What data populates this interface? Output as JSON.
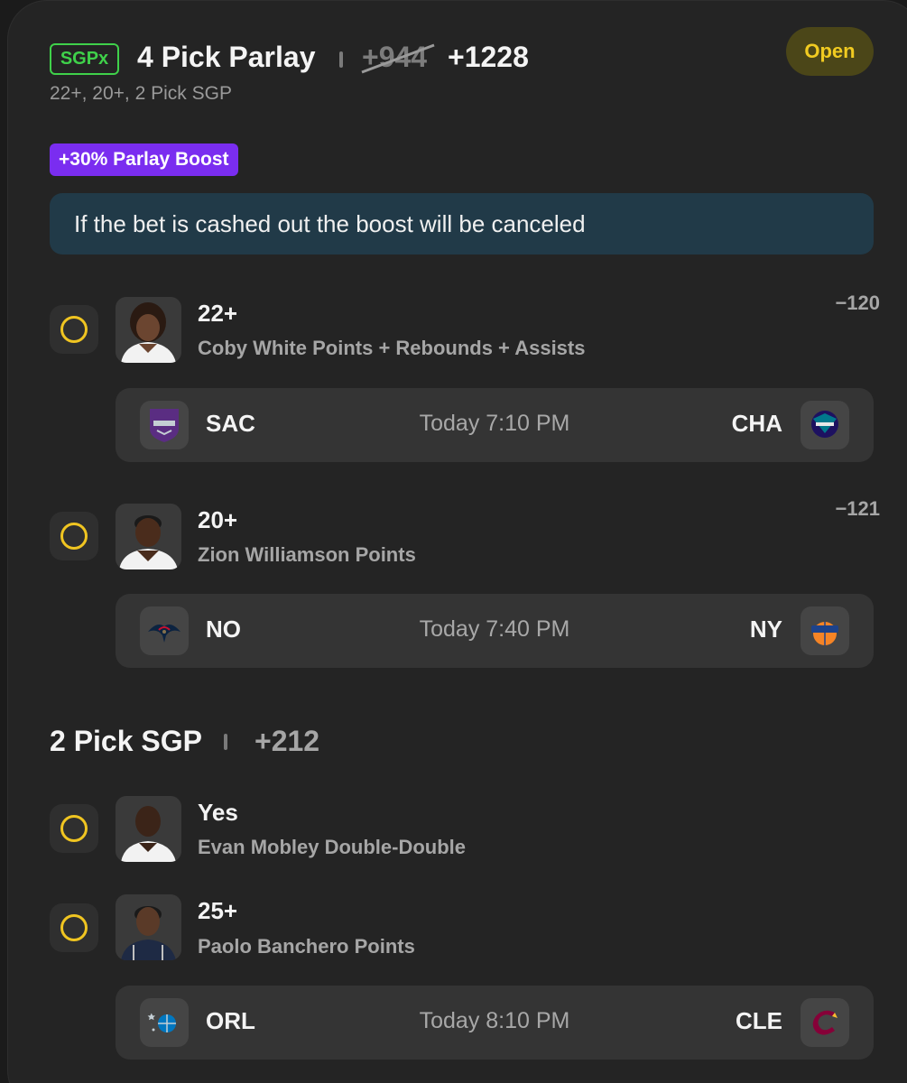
{
  "header": {
    "badge": "SGPx",
    "title": "4 Pick Parlay",
    "odds_original": "+944",
    "odds_boosted": "+1228",
    "subtitle": "22+, 20+, 2 Pick SGP",
    "status": "Open"
  },
  "boost": {
    "badge": "+30% Parlay Boost",
    "notice": "If the bet is cashed out the boost will be canceled"
  },
  "picks": [
    {
      "line": "22+",
      "description": "Coby White Points + Rebounds + Assists",
      "odds": "−120",
      "headshot_icon": "player-headshot-icon"
    },
    {
      "line": "20+",
      "description": "Zion Williamson Points",
      "odds": "−121",
      "headshot_icon": "player-headshot-icon"
    }
  ],
  "games": [
    {
      "away": "SAC",
      "home": "CHA",
      "time": "Today 7:10 PM",
      "away_icon": "kings-logo-icon",
      "home_icon": "hornets-logo-icon"
    },
    {
      "away": "NO",
      "home": "NY",
      "time": "Today 7:40 PM",
      "away_icon": "pelicans-logo-icon",
      "home_icon": "knicks-logo-icon"
    },
    {
      "away": "ORL",
      "home": "CLE",
      "time": "Today 8:10 PM",
      "away_icon": "magic-logo-icon",
      "home_icon": "cavaliers-logo-icon"
    }
  ],
  "sgp": {
    "title": "2 Pick SGP",
    "odds": "+212",
    "picks": [
      {
        "line": "Yes",
        "description": "Evan Mobley Double-Double"
      },
      {
        "line": "25+",
        "description": "Paolo Banchero Points"
      }
    ]
  },
  "colors": {
    "card_bg": "#242424",
    "sgpx_green": "#3fd14a",
    "status_yellow": "#f1cb21",
    "boost_purple": "#7a2df0",
    "banner_blue": "#213a48",
    "radio_yellow": "#f0c521"
  }
}
